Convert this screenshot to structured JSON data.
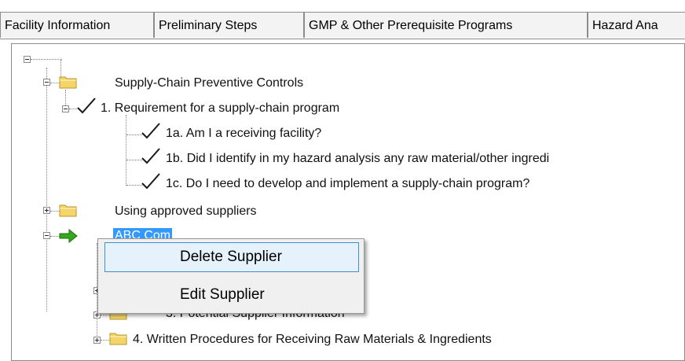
{
  "tabs": [
    {
      "label": "Facility Information"
    },
    {
      "label": "Preliminary Steps"
    },
    {
      "label": "GMP & Other Prerequisite Programs"
    },
    {
      "label": "Hazard Ana"
    }
  ],
  "tree": {
    "supply_chain": "Supply-Chain Preventive Controls",
    "req1": "1. Requirement for a supply-chain program",
    "req1a": "1a. Am I a receiving facility?",
    "req1b": "1b. Did I identify in my hazard analysis any raw material/other ingredi",
    "req1c": "1c. Do I need to develop and implement a supply-chain program?",
    "approved": "Using approved suppliers",
    "abc": "ABC Com",
    "potential": "3. Potential Supplier Information",
    "written": "4. Written Procedures for Receiving Raw Materials & Ingredients"
  },
  "context_menu": {
    "delete": "Delete Supplier",
    "edit": "Edit Supplier"
  },
  "colors": {
    "selection": "#3399ff",
    "folder": "#f5d56a",
    "arrow": "#33aa1c"
  }
}
